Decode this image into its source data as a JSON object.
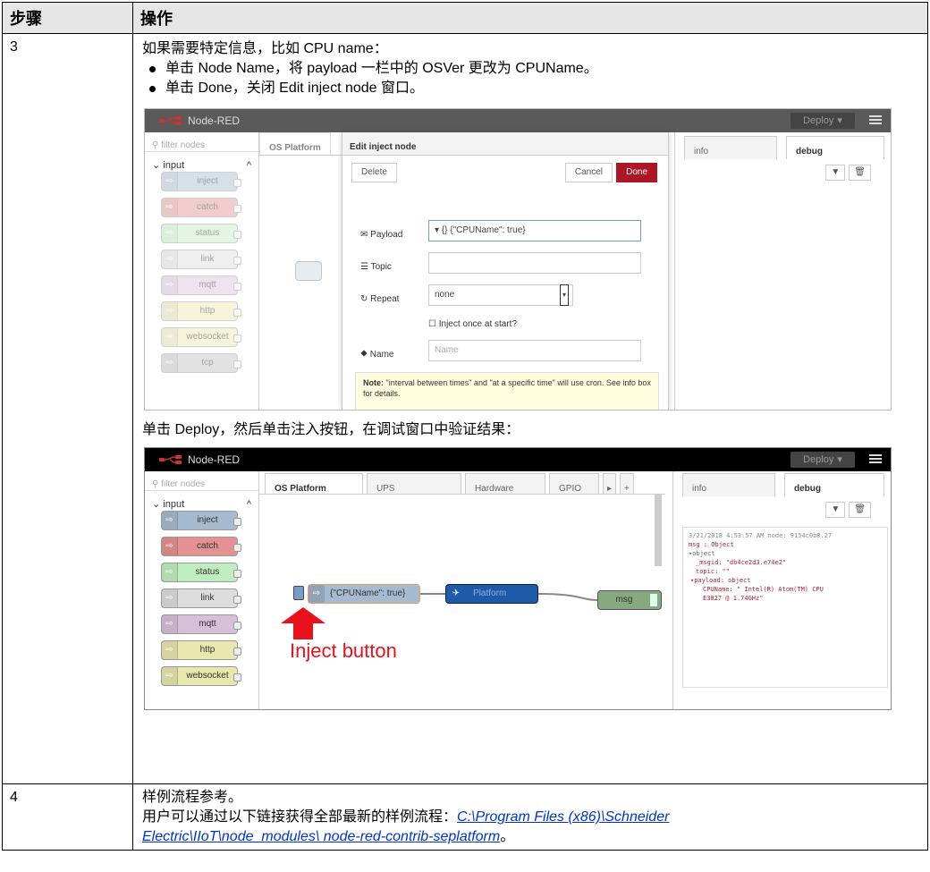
{
  "table": {
    "header": {
      "col_step": "步骤",
      "col_action": "操作"
    },
    "rows": [
      {
        "step": "3",
        "intro": "如果需要特定信息，比如 CPU name：",
        "bullets": [
          "单击 Node Name，将 payload 一栏中的 OSVer 更改为 CPUName。",
          "单击 Done，关闭 Edit inject node 窗口。"
        ],
        "deploy_text": "单击 Deploy，然后单击注入按钮，在调试窗口中验证结果："
      },
      {
        "step": "4",
        "line1": "样例流程参考。",
        "line2_prefix": "用户可以通过以下链接获得全部最新的样例流程：",
        "link_line1": "C:\\Program Files (x86)\\Schneider",
        "link_line2": "Electric\\IIoT\\node_modules\\ node-red-contrib-seplatform",
        "line2_suffix": "。"
      }
    ]
  },
  "shot1": {
    "app_title": "Node-RED",
    "deploy": "Deploy",
    "filter_placeholder": "filter nodes",
    "category": "input",
    "palette": [
      {
        "label": "inject",
        "color": "#a6bbcf"
      },
      {
        "label": "catch",
        "color": "#e49191"
      },
      {
        "label": "status",
        "color": "#c0edc0"
      },
      {
        "label": "link",
        "color": "#dddddd"
      },
      {
        "label": "mqtt",
        "color": "#d8bfd8"
      },
      {
        "label": "http",
        "color": "#e7e7ae"
      },
      {
        "label": "websocket",
        "color": "#e7e7ae"
      },
      {
        "label": "tcp",
        "color": "#c0c0c0"
      }
    ],
    "tab": "OS Platform",
    "dialog_title": "Edit inject node",
    "delete": "Delete",
    "cancel": "Cancel",
    "done": "Done",
    "payload_label": "Payload",
    "payload_value": "{} {\"CPUName\": true}",
    "topic_label": "Topic",
    "repeat_label": "Repeat",
    "repeat_value": "none",
    "inject_once": "Inject once at start?",
    "name_label": "Name",
    "name_placeholder": "Name",
    "note_bold": "Note:",
    "note_text": " \"interval between times\" and \"at a specific time\" will use cron. See info box for details.",
    "side_tabs": [
      "info",
      "debug"
    ]
  },
  "shot2": {
    "app_title": "Node-RED",
    "deploy": "Deploy",
    "filter_placeholder": "filter nodes",
    "category": "input",
    "palette": [
      {
        "label": "inject",
        "color": "#a6bbcf"
      },
      {
        "label": "catch",
        "color": "#e49191"
      },
      {
        "label": "status",
        "color": "#c0edc0"
      },
      {
        "label": "link",
        "color": "#dddddd"
      },
      {
        "label": "mqtt",
        "color": "#d8bfd8"
      },
      {
        "label": "http",
        "color": "#e7e7ae"
      },
      {
        "label": "websocket",
        "color": "#e7e7ae"
      }
    ],
    "tabs": [
      "OS Platform",
      "UPS",
      "Hardware Monitor",
      "GPIO Set"
    ],
    "side_tabs": [
      "info",
      "debug"
    ],
    "flow_inject": "{\"CPUName\": true}",
    "flow_platform": "Platform",
    "flow_msg": "msg",
    "annotation": "Inject button",
    "debug": {
      "timestamp": "3/21/2018 4:53:57 AM   node: 9154c0b8.27",
      "type": "msg : Object",
      "l1": "▾object",
      "l2": "_msgid: \"db4ce2d3.e74e2\"",
      "l3": "topic: \"\"",
      "l4": "▾payload: object",
      "l5": "CPUName: \" Intel(R) Atom(TM) CPU",
      "l6": "E3827 @ 1.74GHz\""
    }
  }
}
